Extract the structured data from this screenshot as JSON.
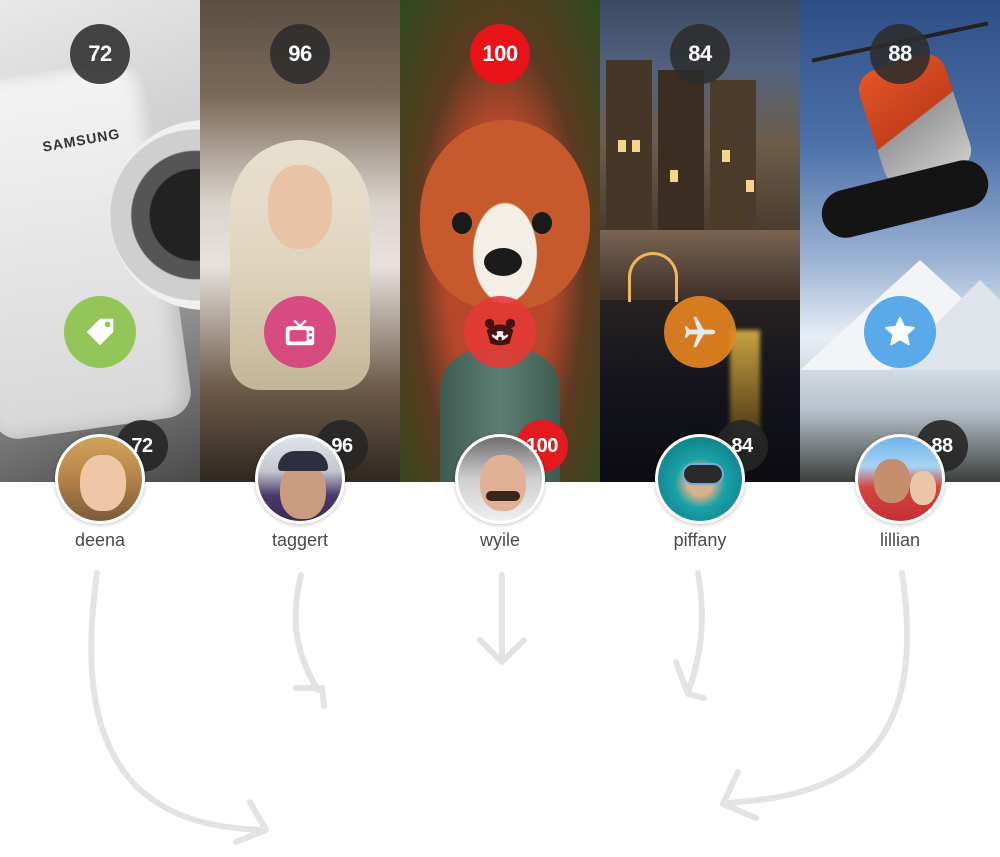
{
  "cards": [
    {
      "id": "deena",
      "score": "72",
      "user_score": "72",
      "username": "deena",
      "category_icon": "tag-icon",
      "category_color": "#8bc34a",
      "highlight": false
    },
    {
      "id": "taggert",
      "score": "96",
      "user_score": "96",
      "username": "taggert",
      "category_icon": "tv-icon",
      "category_color": "#d83f7c",
      "highlight": false
    },
    {
      "id": "wyile",
      "score": "100",
      "user_score": "100",
      "username": "wyile",
      "category_icon": "panda-icon",
      "category_color": "#e53935",
      "highlight": true
    },
    {
      "id": "piffany",
      "score": "84",
      "user_score": "84",
      "username": "piffany",
      "category_icon": "airplane-icon",
      "category_color": "#e8861f",
      "highlight": false
    },
    {
      "id": "lillian",
      "score": "88",
      "user_score": "88",
      "username": "lillian",
      "category_icon": "star-icon",
      "category_color": "#4aa3e8",
      "highlight": false
    }
  ],
  "photo_text": {
    "camera_brand": "SAMSUNG"
  },
  "colors": {
    "score_dark": "#2c2c2c",
    "score_hot": "#e8141a",
    "arrow": "#e3e3e3",
    "name_text": "#4a4a4a"
  }
}
